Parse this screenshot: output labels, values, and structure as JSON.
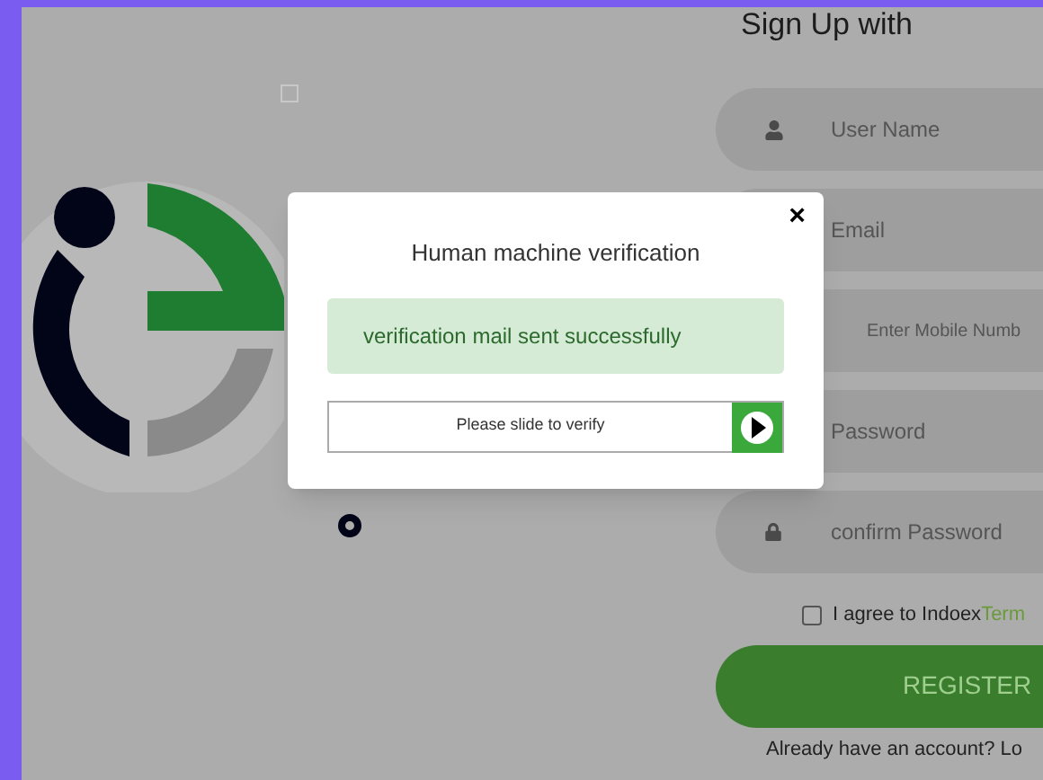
{
  "heading": "Sign Up with",
  "fields": [
    {
      "kind": "user",
      "placeholder": "User Name"
    },
    {
      "kind": "plain",
      "placeholder": "Email"
    },
    {
      "kind": "mobile",
      "placeholder": "Enter Mobile Numb"
    },
    {
      "kind": "plain",
      "placeholder": "Password"
    },
    {
      "kind": "lock",
      "placeholder": "confirm Password"
    }
  ],
  "agree": {
    "checked": false,
    "text": "I agree to Indoex",
    "link": "Term"
  },
  "register": "REGISTER",
  "login_prompt": "Already have an account? Lo",
  "dialog": {
    "title": "Human machine verification",
    "close": "×",
    "message": "verification mail sent successfully",
    "slider": "Please slide to verify",
    "level": 1
  }
}
